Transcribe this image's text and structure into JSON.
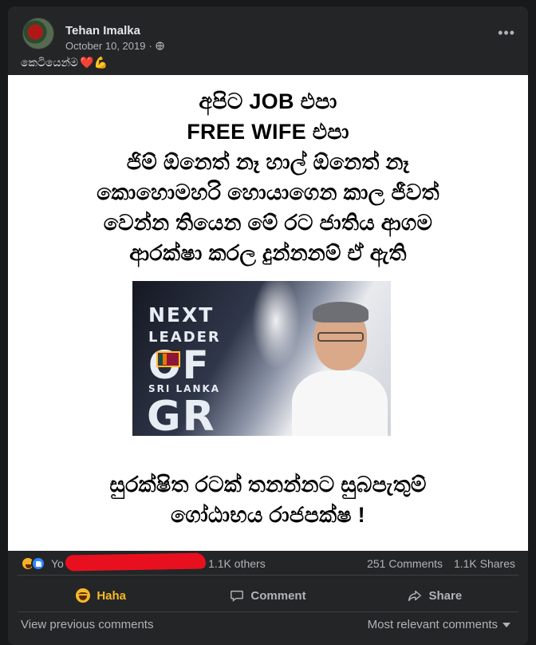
{
  "post": {
    "author": "Tehan Imalka",
    "date": "October 10, 2019",
    "privacy_icon": "globe-icon",
    "more_icon": "more-horizontal-icon",
    "caption_text": "කෙටියෙන්ම",
    "caption_emojis": "❤️💪"
  },
  "image": {
    "lines": [
      "අපිට JOB එපා",
      "FREE WIFE එපා",
      "ජිම් ඕනෙත් නෑ හාල් ඕනෙත් නෑ",
      "කොහොමහරි හොයාගෙන කාල ජීවත්",
      "වෙන්න තියෙන මේ රට ජාතිය ආගම",
      "ආරක්ෂා කරල දුන්නනම් ඒ ඇති"
    ],
    "inset": {
      "next": "NEXT",
      "leader": "LEADER",
      "of": "OF",
      "sri_lanka": "SRI LANKA",
      "gr": "GR"
    },
    "bottom_lines": [
      "සුරක්ෂිත රටක් තනන්නට සුබපැතුම්",
      "ගෝඨාභය රාජපක්ෂ !"
    ]
  },
  "reactions": {
    "names_prefix": "Yo",
    "names_suffix": "and 1.1K others",
    "comments": "251 Comments",
    "shares": "1.1K Shares"
  },
  "actions": {
    "haha": "Haha",
    "comment": "Comment",
    "share": "Share"
  },
  "comments_bar": {
    "view_previous": "View previous comments",
    "sort": "Most relevant comments"
  },
  "colors": {
    "background": "#18191a",
    "card": "#242526",
    "text_primary": "#e4e6eb",
    "text_secondary": "#b0b3b8",
    "haha": "#f7b928",
    "redaction": "#e8101f"
  }
}
